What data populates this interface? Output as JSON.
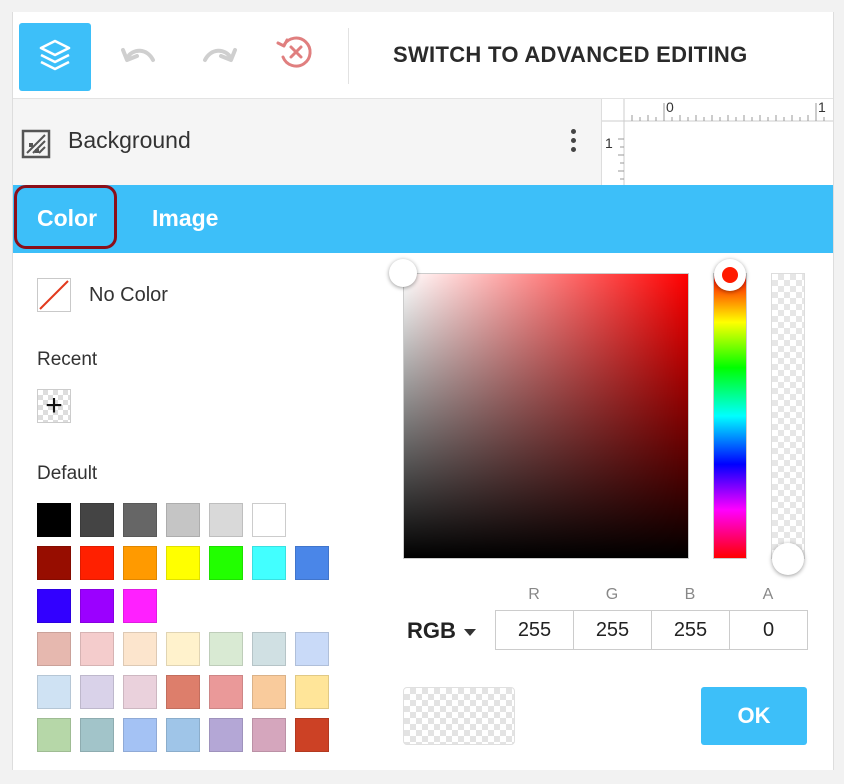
{
  "toolbar": {
    "advanced_label": "SWITCH TO ADVANCED EDITING",
    "icons": [
      "layers-icon",
      "undo-icon",
      "redo-icon",
      "reset-icon"
    ]
  },
  "layer": {
    "label": "Background",
    "icon": "background-pattern-icon"
  },
  "ruler": {
    "top_labels": [
      "0",
      "1"
    ],
    "side_label": "1"
  },
  "tabs": [
    {
      "label": "Color",
      "active": true
    },
    {
      "label": "Image",
      "active": false
    }
  ],
  "no_color": {
    "label": "No Color"
  },
  "recent": {
    "title": "Recent",
    "add_symbol": "+"
  },
  "default": {
    "title": "Default",
    "rows": [
      [
        "#000000",
        "#444444",
        "#666666",
        "#c5c5c5",
        "#d9d9d9",
        "#ffffff"
      ],
      [
        "#970d00",
        "#ff2000",
        "#ff9a00",
        "#ffff00",
        "#22ff00",
        "#42ffff",
        "#4a86e8"
      ],
      [
        "#3200ff",
        "#9b00ff",
        "#ff20ff"
      ],
      [
        "#e6b8af",
        "#f4cccc",
        "#fce5cd",
        "#fff2cc",
        "#d9ead3",
        "#d0e0e3",
        "#c9daf8"
      ],
      [
        "#cfe2f3",
        "#d9d2e9",
        "#ead1dc",
        "#dd7e6b",
        "#ea9999",
        "#f9cb9c",
        "#ffe599"
      ],
      [
        "#b6d7a8",
        "#a2c4c9",
        "#a4c2f4",
        "#9fc5e8",
        "#b4a7d6",
        "#d5a6bd",
        "#cc4125"
      ]
    ]
  },
  "picker": {
    "hue_color": "#ff0000",
    "mode": "RGB",
    "channels": [
      {
        "label": "R",
        "value": "255"
      },
      {
        "label": "G",
        "value": "255"
      },
      {
        "label": "B",
        "value": "255"
      },
      {
        "label": "A",
        "value": "0"
      }
    ],
    "ok_label": "OK"
  },
  "colors": {
    "accent": "#3dbff9",
    "tab_highlight": "#8b0f1a"
  }
}
